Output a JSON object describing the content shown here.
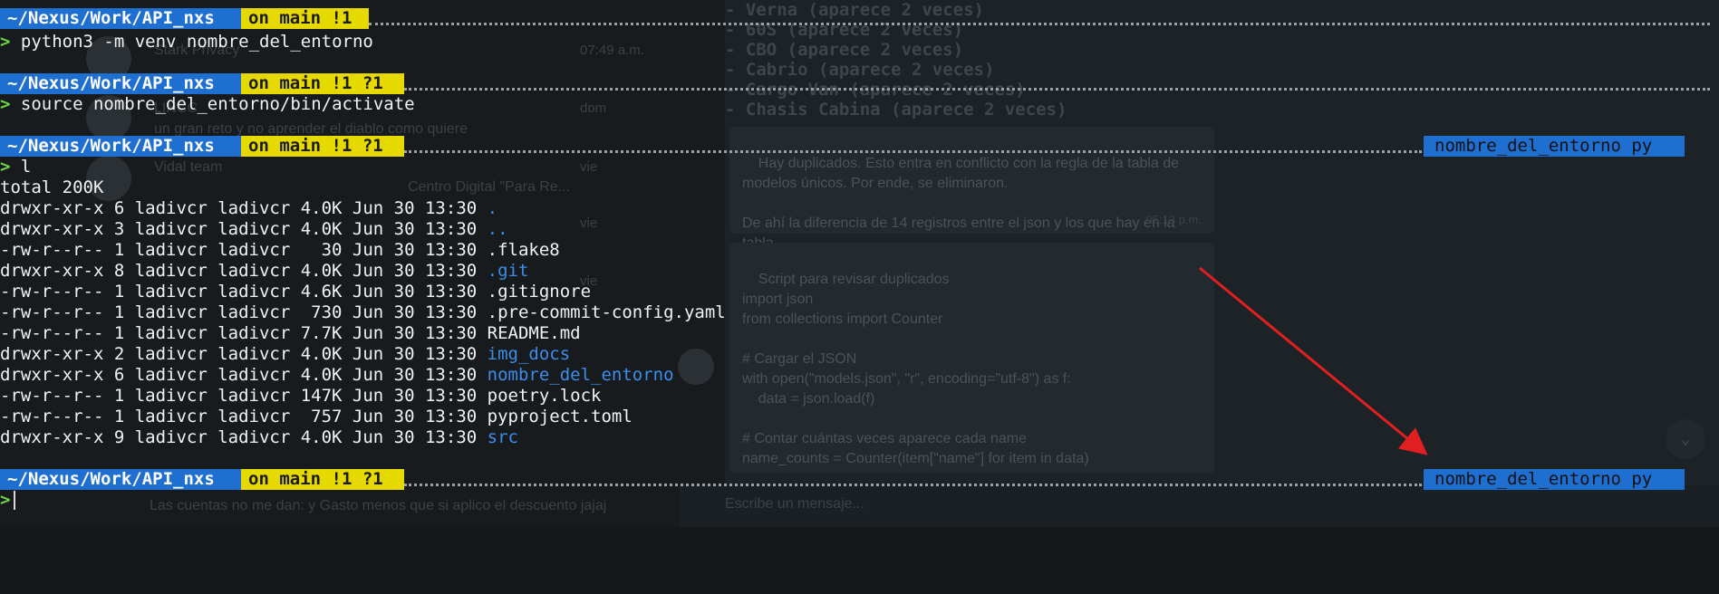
{
  "background": {
    "chat_list": [
      {
        "name": "Stark Privacy",
        "time": "07:49 a.m."
      },
      {
        "name": "LINCC",
        "time": "dom"
      },
      {
        "name": "Vidal team",
        "time": "vie"
      },
      {
        "name": "",
        "time": "vie"
      },
      {
        "name": "",
        "time": "vie"
      }
    ],
    "chat_preview_1": "un gran reto y no aprender el diablo como quiere",
    "chat_preview_2": "Centro Digital \"Para Re...",
    "bottom_preview": "Las cuentas no me dan: y Gasto menos que si aplico el descuento jajaj",
    "code_lines": [
      "- Verna (aparece 2 veces)",
      "- 60S (aparece 2 veces)",
      "- CBO (aparece 2 veces)",
      "- Cabrio (aparece 2 veces)",
      "- Cargo Van (aparece 2 veces)",
      "- Chasis Cabina (aparece 2 veces)"
    ],
    "message_1": "Hay duplicados. Esto entra en conflicto con la regla de la tabla de\nmodelos únicos. Por ende, se eliminaron.\n\nDe ahí la diferencia de 14 registros entre el json y los que hay en la\ntabla.",
    "message_1_time": "05:13 p.m.",
    "message_2": "Script para revisar duplicados\nimport json\nfrom collections import Counter\n\n# Cargar el JSON\nwith open(\"models.json\", \"r\", encoding=\"utf-8\") as f:\n    data = json.load(f)\n\n# Contar cuántas veces aparece cada name\nname_counts = Counter(item[\"name\"] for item in data)",
    "input_placeholder": "Escribe un mensaje..."
  },
  "terminal": {
    "prompt_char": ">",
    "prompts": [
      {
        "path": "~/Nexus/Work/API_nxs",
        "git": "on main !1",
        "venv": "",
        "command": "python3 -m venv nombre_del_entorno"
      },
      {
        "path": "~/Nexus/Work/API_nxs",
        "git": "on main !1 ?1",
        "venv": "",
        "command": "source nombre_del_entorno/bin/activate"
      },
      {
        "path": "~/Nexus/Work/API_nxs",
        "git": "on main !1 ?1",
        "venv": "nombre_del_entorno py",
        "command": "l"
      },
      {
        "path": "~/Nexus/Work/API_nxs",
        "git": "on main !1 ?1",
        "venv": "nombre_del_entorno py",
        "command": ""
      }
    ],
    "ls_total": "total 200K",
    "ls_entries": [
      {
        "meta": "drwxr-xr-x 6 ladivcr ladivcr 4.0K Jun 30 13:30 ",
        "name": ".",
        "is_dir": true
      },
      {
        "meta": "drwxr-xr-x 3 ladivcr ladivcr 4.0K Jun 30 13:30 ",
        "name": "..",
        "is_dir": true
      },
      {
        "meta": "-rw-r--r-- 1 ladivcr ladivcr   30 Jun 30 13:30 ",
        "name": ".flake8",
        "is_dir": false
      },
      {
        "meta": "drwxr-xr-x 8 ladivcr ladivcr 4.0K Jun 30 13:30 ",
        "name": ".git",
        "is_dir": true
      },
      {
        "meta": "-rw-r--r-- 1 ladivcr ladivcr 4.6K Jun 30 13:30 ",
        "name": ".gitignore",
        "is_dir": false
      },
      {
        "meta": "-rw-r--r-- 1 ladivcr ladivcr  730 Jun 30 13:30 ",
        "name": ".pre-commit-config.yaml",
        "is_dir": false
      },
      {
        "meta": "-rw-r--r-- 1 ladivcr ladivcr 7.7K Jun 30 13:30 ",
        "name": "README.md",
        "is_dir": false
      },
      {
        "meta": "drwxr-xr-x 2 ladivcr ladivcr 4.0K Jun 30 13:30 ",
        "name": "img_docs",
        "is_dir": true
      },
      {
        "meta": "drwxr-xr-x 6 ladivcr ladivcr 4.0K Jun 30 13:30 ",
        "name": "nombre_del_entorno",
        "is_dir": true
      },
      {
        "meta": "-rw-r--r-- 1 ladivcr ladivcr 147K Jun 30 13:30 ",
        "name": "poetry.lock",
        "is_dir": false
      },
      {
        "meta": "-rw-r--r-- 1 ladivcr ladivcr  757 Jun 30 13:30 ",
        "name": "pyproject.toml",
        "is_dir": false
      },
      {
        "meta": "drwxr-xr-x 9 ladivcr ladivcr 4.0K Jun 30 13:30 ",
        "name": "src",
        "is_dir": true
      }
    ]
  },
  "colors": {
    "path_segment": "#1f6fd1",
    "git_segment": "#e6d900",
    "prompt_char": "#6fd83e",
    "directory": "#3b8eea",
    "annotation_arrow": "#e02020"
  }
}
